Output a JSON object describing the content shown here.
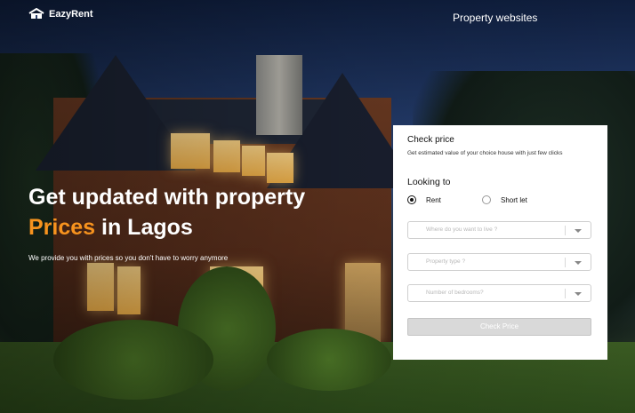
{
  "brand": {
    "name": "EazyRent"
  },
  "nav": {
    "link": "Property websites"
  },
  "hero": {
    "title_line1": "Get updated with property",
    "title_accent": "Prices",
    "title_line2_rest": " in Lagos",
    "subtitle": "We provide you with prices so you don't have to worry anymore"
  },
  "card": {
    "title": "Check price",
    "subtitle": "Get estimated value of your choice house with just few clicks",
    "looking_title": "Looking to",
    "options": [
      {
        "label": "Rent",
        "selected": true
      },
      {
        "label": "Short let",
        "selected": false
      }
    ],
    "location_placeholder": "Where do you want to live ?",
    "property_type_placeholder": "Property type ?",
    "bedrooms_placeholder": "Number of bedrooms?",
    "button_label": "Check Price"
  },
  "colors": {
    "accent": "#f7931e",
    "card_bg": "#ffffff",
    "button_bg": "#d9d9d9"
  },
  "icons": [
    "house-logo-icon",
    "chevron-down-icon"
  ]
}
